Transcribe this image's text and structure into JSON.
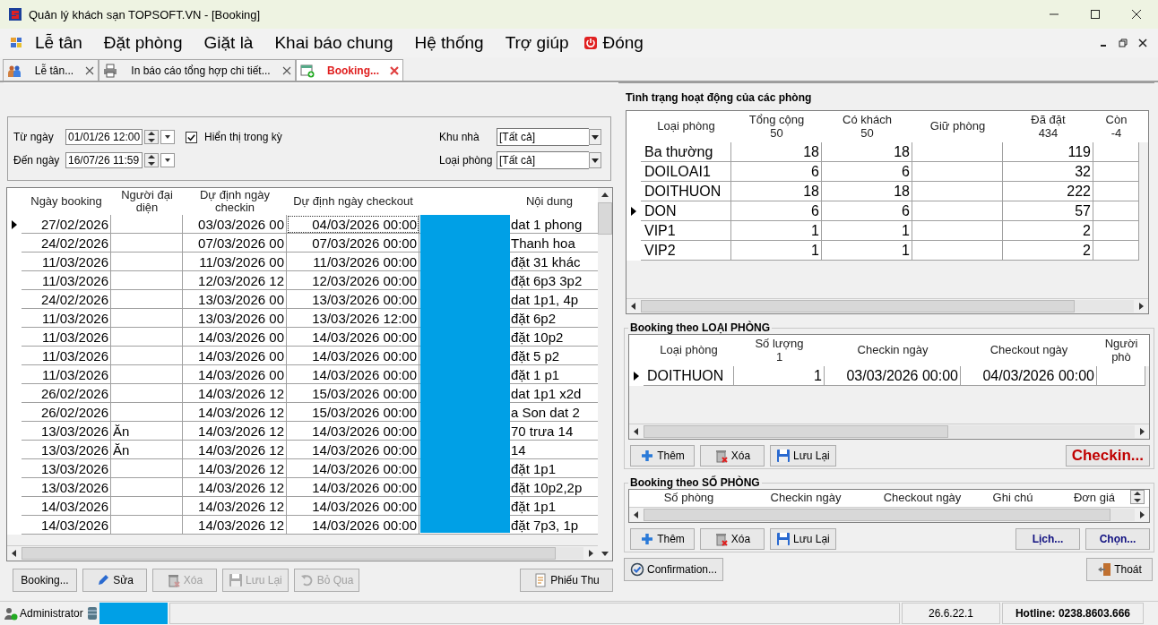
{
  "window": {
    "title": "Quản lý khách sạn TOPSOFT.VN - [Booking]"
  },
  "menu": [
    "Lễ tân",
    "Đặt phòng",
    "Giặt là",
    "Khai báo chung",
    "Hệ thống",
    "Trợ giúp"
  ],
  "close_menu": "Đóng",
  "tabs": [
    {
      "label": "Lễ tân...",
      "kind": "people",
      "selected": false
    },
    {
      "label": "In báo cáo tổng hợp chi tiết...",
      "kind": "printer",
      "selected": false
    },
    {
      "label": "Booking...",
      "kind": "calendar",
      "selected": true
    }
  ],
  "filter": {
    "from_label": "Từ ngày",
    "from_value": "01/01/26 12:00",
    "to_label": "Đến ngày",
    "to_value": "16/07/26 11:59",
    "show_in_period": {
      "label": "Hiển thị trong kỳ",
      "checked": true
    },
    "building_label": "Khu nhà",
    "building_value": "[Tất cả]",
    "room_type_label": "Loại phòng",
    "room_type_value": "[Tất cả]"
  },
  "bookings": {
    "columns": [
      "Ngày booking",
      "Người đại\ndiện",
      "Dự định ngày\ncheckin",
      "Dự định ngày checkout",
      "Nội dung"
    ],
    "rows": [
      {
        "cells": [
          "27/02/2026",
          null,
          "03/03/2026 00",
          "04/03/2026 00:00",
          "dat 1 phong"
        ],
        "selected": true
      },
      {
        "cells": [
          "24/02/2026",
          null,
          "07/03/2026 00",
          "07/03/2026 00:00",
          "Thanh hoa"
        ],
        "selected": false
      },
      {
        "cells": [
          "11/03/2026",
          null,
          "11/03/2026 00",
          "11/03/2026 00:00",
          "đặt 31 khác"
        ],
        "selected": false
      },
      {
        "cells": [
          "11/03/2026",
          null,
          "12/03/2026 12",
          "12/03/2026 00:00",
          "đặt 6p3 3p2"
        ],
        "selected": false
      },
      {
        "cells": [
          "24/02/2026",
          null,
          "13/03/2026 00",
          "13/03/2026 00:00",
          "dat 1p1, 4p"
        ],
        "selected": false
      },
      {
        "cells": [
          "11/03/2026",
          null,
          "13/03/2026 00",
          "13/03/2026 12:00",
          "đặt 6p2"
        ],
        "selected": false
      },
      {
        "cells": [
          "11/03/2026",
          null,
          "14/03/2026 00",
          "14/03/2026 00:00",
          "đặt 10p2"
        ],
        "selected": false
      },
      {
        "cells": [
          "11/03/2026",
          null,
          "14/03/2026 00",
          "14/03/2026 00:00",
          "đặt 5 p2"
        ],
        "selected": false
      },
      {
        "cells": [
          "11/03/2026",
          null,
          "14/03/2026 00",
          "14/03/2026 00:00",
          "đặt 1 p1"
        ],
        "selected": false
      },
      {
        "cells": [
          "26/02/2026",
          null,
          "14/03/2026 12",
          "15/03/2026 00:00",
          "dat 1p1 x2d"
        ],
        "selected": false
      },
      {
        "cells": [
          "26/02/2026",
          null,
          "14/03/2026 12",
          "15/03/2026 00:00",
          "a Son dat 2"
        ],
        "selected": false
      },
      {
        "cells": [
          "13/03/2026",
          "Ăn",
          "14/03/2026 12",
          "14/03/2026 00:00",
          "70 trưa 14"
        ],
        "selected": false
      },
      {
        "cells": [
          "13/03/2026",
          "Ăn",
          "14/03/2026 12",
          "14/03/2026 00:00",
          "14"
        ],
        "selected": false
      },
      {
        "cells": [
          "13/03/2026",
          null,
          "14/03/2026 12",
          "14/03/2026 00:00",
          "đặt 1p1"
        ],
        "selected": false
      },
      {
        "cells": [
          "13/03/2026",
          null,
          "14/03/2026 12",
          "14/03/2026 00:00",
          "đặt 10p2,2p"
        ],
        "selected": false
      },
      {
        "cells": [
          "14/03/2026",
          null,
          "14/03/2026 12",
          "14/03/2026 00:00",
          "đặt 1p1"
        ],
        "selected": false
      },
      {
        "cells": [
          "14/03/2026",
          null,
          "14/03/2026 12",
          "14/03/2026 00:00",
          "đặt 7p3, 1p"
        ],
        "selected": false
      }
    ]
  },
  "booking_buttons": [
    {
      "label": "Booking...",
      "kind": "plain",
      "disabled": false
    },
    {
      "label": "Sửa",
      "kind": "edit",
      "disabled": false
    },
    {
      "label": "Xóa",
      "kind": "delete",
      "disabled": true
    },
    {
      "label": "Lưu Lại",
      "kind": "save",
      "disabled": true
    },
    {
      "label": "Bỏ Qua",
      "kind": "undo",
      "disabled": true
    }
  ],
  "receipt_button": {
    "label": "Phiếu Thu",
    "kind": "receipt",
    "disabled": false
  },
  "room_status": {
    "title": "Tình trạng hoạt động của các phòng",
    "columns": [
      "Loại phòng",
      "Tổng cộng\n50",
      "Có khách\n50",
      "Giữ phòng",
      "Đã đặt\n434",
      "Còn\n-4"
    ],
    "rows": [
      {
        "cells": [
          "Ba thường",
          "18",
          "18",
          null,
          "119",
          null
        ],
        "selected": false
      },
      {
        "cells": [
          "DOILOAI1",
          "6",
          "6",
          null,
          "32",
          null
        ],
        "selected": false
      },
      {
        "cells": [
          "DOITHUON",
          "18",
          "18",
          null,
          "222",
          null
        ],
        "selected": false
      },
      {
        "cells": [
          "DON",
          "6",
          "6",
          null,
          "57",
          null
        ],
        "selected": true
      },
      {
        "cells": [
          "VIP1",
          "1",
          "1",
          null,
          "2",
          null
        ],
        "selected": false
      },
      {
        "cells": [
          "VIP2",
          "1",
          "1",
          null,
          "2",
          null
        ],
        "selected": false
      }
    ]
  },
  "by_room_type": {
    "title": "Booking theo LOẠI PHÒNG",
    "columns": [
      "Loại phòng",
      "Số lượng\n1",
      "Checkin ngày",
      "Checkout ngày",
      "Người\nphò"
    ],
    "rows": [
      {
        "cells": [
          "DOITHUON",
          "1",
          "03/03/2026 00:00",
          "04/03/2026 00:00",
          null
        ],
        "selected": true
      }
    ],
    "buttons": [
      {
        "label": "Thêm",
        "kind": "add",
        "disabled": false
      },
      {
        "label": "Xóa",
        "kind": "delete",
        "disabled": false
      },
      {
        "label": "Lưu Lại",
        "kind": "save",
        "disabled": false
      },
      {
        "label": "Checkin...",
        "kind": "checkin",
        "disabled": false
      }
    ]
  },
  "by_room_number": {
    "title": "Booking theo SỐ PHÒNG",
    "columns": [
      "Số phòng",
      "Checkin ngày",
      "Checkout ngày",
      "Ghi chú",
      "Đơn giá"
    ],
    "buttons": [
      {
        "label": "Thêm",
        "kind": "add",
        "disabled": false
      },
      {
        "label": "Xóa",
        "kind": "delete",
        "disabled": false
      },
      {
        "label": "Lưu Lại",
        "kind": "save",
        "disabled": false
      },
      {
        "label": "Lịch...",
        "kind": "link",
        "disabled": false
      },
      {
        "label": "Chọn...",
        "kind": "link",
        "disabled": false
      }
    ]
  },
  "footer_buttons": [
    {
      "label": "Confirmation...",
      "kind": "confirm",
      "disabled": false
    },
    {
      "label": "Thoát",
      "kind": "exit",
      "disabled": false
    }
  ],
  "status_bar": {
    "user": "Administrator",
    "version": "26.6.22.1",
    "hotline": "Hotline: 0238.8603.666"
  }
}
